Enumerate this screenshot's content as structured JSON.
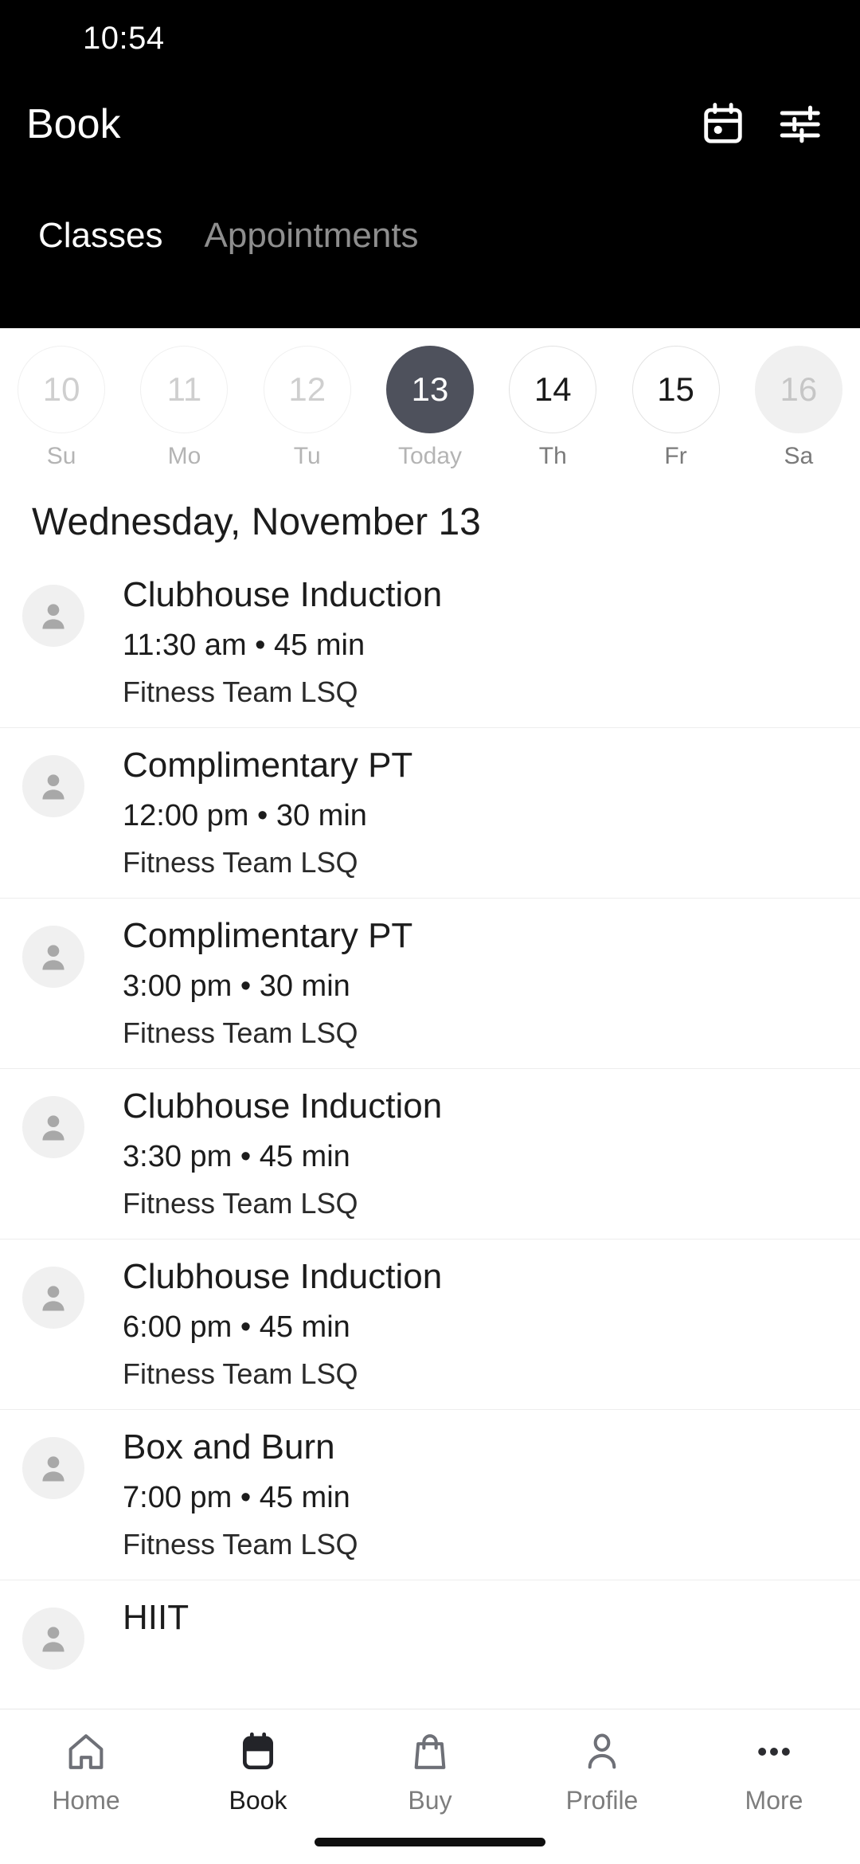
{
  "status_bar": {
    "time": "10:54"
  },
  "header": {
    "title": "Book",
    "calendar_icon": "calendar-icon",
    "filter_icon": "filter-sliders-icon",
    "tabs": [
      {
        "label": "Classes",
        "active": true
      },
      {
        "label": "Appointments",
        "active": false
      }
    ]
  },
  "colors": {
    "header_bg": "#000000",
    "selected_day_bg": "#4e515c",
    "muted_day_bg": "#f0f0f0",
    "text_primary": "#1c1c1c",
    "text_muted": "#b4b4b4",
    "divider": "#ededed"
  },
  "date_strip": {
    "days": [
      {
        "number": "10",
        "weekday": "Su",
        "state": "past"
      },
      {
        "number": "11",
        "weekday": "Mo",
        "state": "past"
      },
      {
        "number": "12",
        "weekday": "Tu",
        "state": "past"
      },
      {
        "number": "13",
        "weekday": "Today",
        "state": "selected"
      },
      {
        "number": "14",
        "weekday": "Th",
        "state": "future"
      },
      {
        "number": "15",
        "weekday": "Fr",
        "state": "future"
      },
      {
        "number": "16",
        "weekday": "Sa",
        "state": "muted"
      }
    ]
  },
  "main": {
    "date_heading": "Wednesday, November 13",
    "classes": [
      {
        "title": "Clubhouse Induction",
        "meta": "11:30 am • 45 min",
        "instructor": "Fitness Team LSQ",
        "avatar_icon": "person-avatar-icon"
      },
      {
        "title": "Complimentary PT",
        "meta": "12:00 pm • 30 min",
        "instructor": "Fitness Team LSQ",
        "avatar_icon": "person-avatar-icon"
      },
      {
        "title": "Complimentary PT",
        "meta": "3:00 pm • 30 min",
        "instructor": "Fitness Team LSQ",
        "avatar_icon": "person-avatar-icon"
      },
      {
        "title": "Clubhouse Induction",
        "meta": "3:30 pm • 45 min",
        "instructor": "Fitness Team LSQ",
        "avatar_icon": "person-avatar-icon"
      },
      {
        "title": "Clubhouse Induction",
        "meta": "6:00 pm • 45 min",
        "instructor": "Fitness Team LSQ",
        "avatar_icon": "person-avatar-icon"
      },
      {
        "title": "Box and Burn",
        "meta": "7:00 pm • 45 min",
        "instructor": "Fitness Team LSQ",
        "avatar_icon": "person-avatar-icon"
      },
      {
        "title": "HIIT",
        "meta": "",
        "instructor": "",
        "avatar_icon": "person-avatar-icon"
      }
    ]
  },
  "bottom_nav": {
    "items": [
      {
        "label": "Home",
        "icon": "home-icon",
        "active": false
      },
      {
        "label": "Book",
        "icon": "calendar-icon",
        "active": true
      },
      {
        "label": "Buy",
        "icon": "shopping-bag-icon",
        "active": false
      },
      {
        "label": "Profile",
        "icon": "person-icon",
        "active": false
      },
      {
        "label": "More",
        "icon": "ellipsis-icon",
        "active": false
      }
    ]
  }
}
